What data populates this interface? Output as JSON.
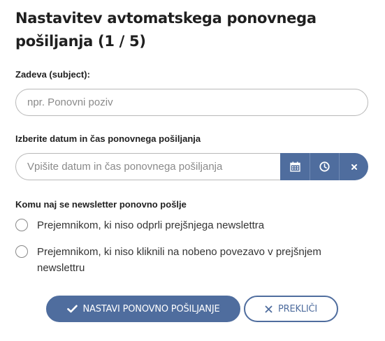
{
  "dialog": {
    "title": "Nastavitev avtomatskega ponovnega pošiljanja (1 / 5)"
  },
  "subject": {
    "label": "Zadeva (subject):",
    "value": "",
    "placeholder": "npr. Ponovni poziv"
  },
  "datetime": {
    "label": "Izberite datum in čas ponovnega pošiljanja",
    "value": "",
    "placeholder": "Vpišite datum in čas ponovnega pošiljanja",
    "icons": [
      "calendar-icon",
      "clock-icon",
      "close-icon"
    ]
  },
  "recipients": {
    "label": "Komu naj se newsletter ponovno pošlje",
    "options": [
      {
        "label": "Prejemnikom, ki niso odprli prejšnjega newslettra",
        "selected": false
      },
      {
        "label": "Prejemnikom, ki niso kliknili na nobeno povezavo v prejšnjem newslettru",
        "selected": false
      }
    ]
  },
  "actions": {
    "confirm_label": "NASTAVI PONOVNO POŠILJANJE",
    "cancel_label": "PREKLIČI"
  },
  "colors": {
    "accent": "#4f6d9e",
    "border": "#b8b8b8",
    "text": "#333333"
  }
}
